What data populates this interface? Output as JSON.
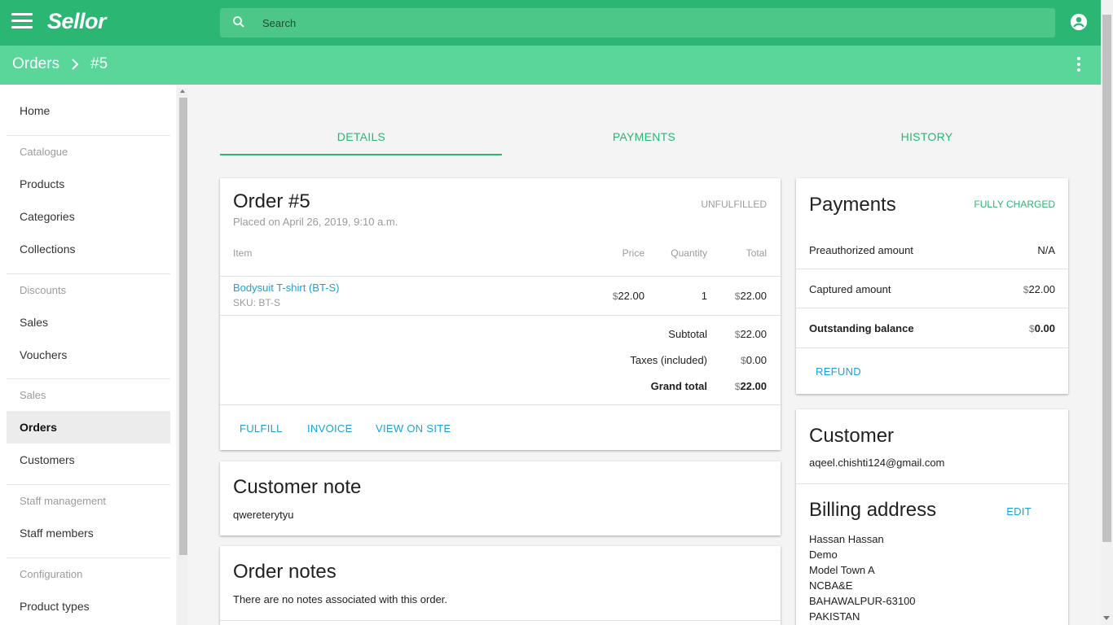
{
  "app": {
    "logo": "Sellor"
  },
  "search": {
    "placeholder": "Search"
  },
  "breadcrumb": {
    "root": "Orders",
    "current": "#5"
  },
  "sidebar": {
    "home": "Home",
    "catalogue_header": "Catalogue",
    "products": "Products",
    "categories": "Categories",
    "collections": "Collections",
    "discounts_header": "Discounts",
    "sales_item": "Sales",
    "vouchers": "Vouchers",
    "sales_header": "Sales",
    "orders": "Orders",
    "customers": "Customers",
    "staff_header": "Staff management",
    "staff_members": "Staff members",
    "config_header": "Configuration",
    "product_types": "Product types"
  },
  "tabs": [
    "DETAILS",
    "PAYMENTS",
    "HISTORY"
  ],
  "order": {
    "title": "Order #5",
    "status": "UNFULFILLED",
    "placed": "Placed on April 26, 2019, 9:10 a.m.",
    "columns": {
      "item": "Item",
      "price": "Price",
      "quantity": "Quantity",
      "total": "Total"
    },
    "line": {
      "name": "Bodysuit T-shirt (BT-S)",
      "sku": "SKU: BT-S",
      "price": "22.00",
      "quantity": "1",
      "total": "22.00"
    },
    "currency_symbol": "$",
    "subtotal_label": "Subtotal",
    "subtotal": "22.00",
    "taxes_label": "Taxes (included)",
    "taxes": "0.00",
    "grand_label": "Grand total",
    "grand": "22.00",
    "actions": {
      "fulfill": "FULFILL",
      "invoice": "INVOICE",
      "view": "VIEW ON SITE"
    }
  },
  "customer_note": {
    "title": "Customer note",
    "text": "qwereterytyu"
  },
  "order_notes": {
    "title": "Order notes",
    "text": "There are no notes associated with this order."
  },
  "payments": {
    "title": "Payments",
    "status": "FULLY CHARGED",
    "preauth_label": "Preauthorized amount",
    "preauth": "N/A",
    "captured_label": "Captured amount",
    "captured": "22.00",
    "outstanding_label": "Outstanding balance",
    "outstanding": "0.00",
    "refund": "REFUND"
  },
  "customer": {
    "title": "Customer",
    "email": "aqeel.chishti124@gmail.com",
    "billing_title": "Billing address",
    "edit": "EDIT",
    "address": [
      "Hassan Hassan",
      "Demo",
      "Model Town A",
      "NCBA&E",
      "BAHAWALPUR-63100",
      "PAKISTAN"
    ]
  },
  "colors": {
    "primary": "#2bb673",
    "subbar": "#5ad69a",
    "link": "#1aa3d6"
  }
}
